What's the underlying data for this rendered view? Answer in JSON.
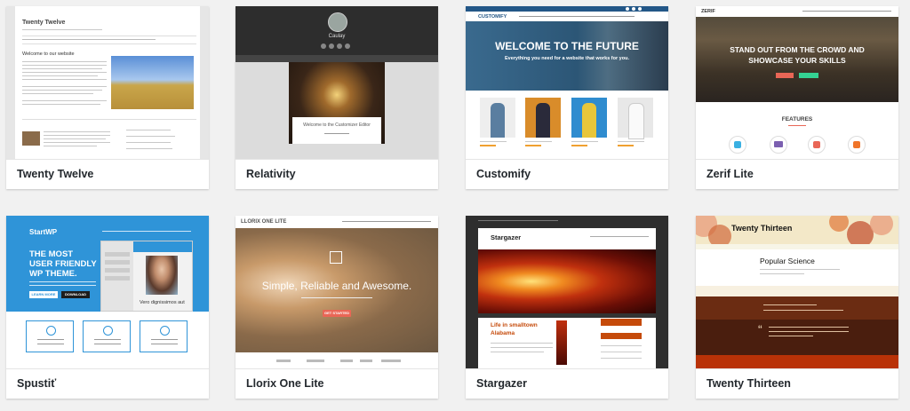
{
  "themes": [
    {
      "name": "Twenty Twelve",
      "preview": {
        "site_title": "Twenty Twelve",
        "heading": "Welcome to our website"
      }
    },
    {
      "name": "Relativity",
      "preview": {
        "site_title": "Caulay",
        "box_title": "Welcome to the Customizer Editor"
      }
    },
    {
      "name": "Customify",
      "preview": {
        "logo": "CUSTOMIFY",
        "hero_title": "WELCOME TO THE FUTURE",
        "hero_subtitle": "Everything you need for a website that works for you."
      }
    },
    {
      "name": "Zerif Lite",
      "preview": {
        "logo": "ZERIF",
        "hero_title_1": "STAND OUT FROM THE CROWD AND",
        "hero_title_2": "SHOWCASE YOUR SKILLS",
        "section_title": "FEATURES"
      }
    },
    {
      "name": "Spustiť",
      "preview": {
        "logo": "StartWP",
        "hero_1": "THE MOST",
        "hero_2": "USER FRIENDLY",
        "hero_3": "WP THEME.",
        "button_1": "LEARN MORE",
        "button_2": "DOWNLOAD",
        "caption": "Vero dignissimos aut"
      }
    },
    {
      "name": "Llorix One Lite",
      "preview": {
        "logo": "LLORIX ONE LITE",
        "hero_title": "Simple, Reliable and Awesome.",
        "button": "GET STARTED"
      }
    },
    {
      "name": "Stargazer",
      "preview": {
        "site_title": "Stargazer",
        "post_title_1": "Life in smalltown",
        "post_title_2": "Alabama"
      }
    },
    {
      "name": "Twenty Thirteen",
      "preview": {
        "site_title": "Twenty Thirteen",
        "post_title": "Popular Science"
      }
    }
  ],
  "colors": {
    "accent_blue": "#2f94d8",
    "zerif_red": "#e96656",
    "zerif_green": "#34d293",
    "customify_blue": "#235787",
    "thirteen_brown": "#6b2c12",
    "llorix_orange": "#e96656"
  }
}
